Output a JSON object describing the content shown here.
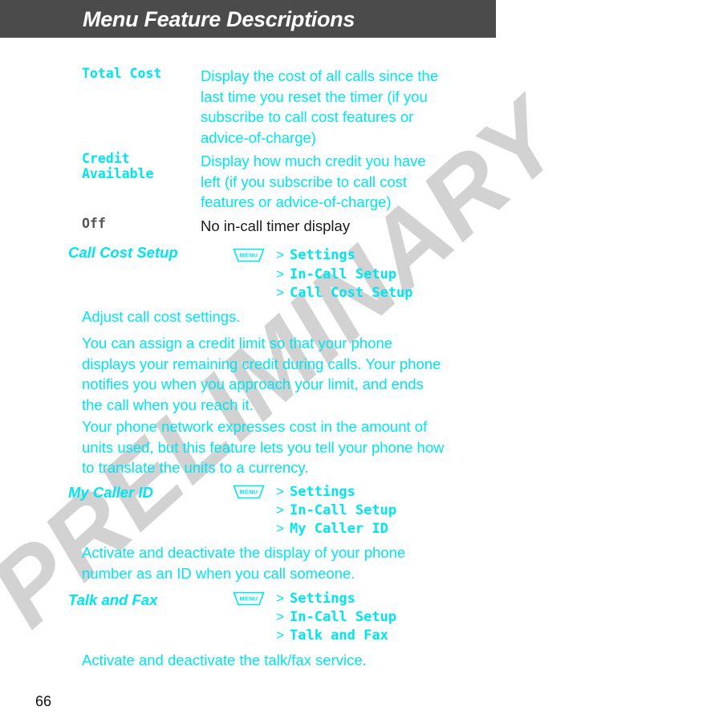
{
  "header": {
    "title": "Menu Feature Descriptions",
    "bar_color": "#4b4b4b",
    "text_color": "#ffffff"
  },
  "watermark": {
    "text": "PRELIMINARY",
    "color": "#d2d2d2"
  },
  "colors": {
    "accent_cyan": "#00e5f2",
    "body_dark": "#1a1a1a",
    "term_gray": "#555555"
  },
  "definitions": [
    {
      "term": "Total Cost",
      "term_color": "#00e5f2",
      "desc": "Display the cost of all calls since the last time you reset the timer (if you subscribe to call cost features or advice-of-charge)",
      "desc_color": "#00e5f2"
    },
    {
      "term": "Credit Available",
      "term_color": "#00e5f2",
      "desc": "Display how much credit you have left (if you subscribe to call cost features or advice-of-charge)",
      "desc_color": "#00e5f2"
    },
    {
      "term": "Off",
      "term_color": "#555555",
      "desc": "No in-call timer display",
      "desc_color": "#1a1a1a"
    }
  ],
  "features": [
    {
      "name": "Call Cost Setup",
      "menu_icon": "menu-key-icon",
      "menu_icon_label": "MENU",
      "path": [
        "Settings",
        "In-Call Setup",
        "Call Cost Setup"
      ],
      "paragraphs": [
        "Adjust call cost settings.",
        "You can assign a credit limit so that your phone displays your remaining credit during calls. Your phone notifies you when you approach your limit, and ends the call when you reach it.",
        "Your phone network expresses cost in the amount of units used, but this feature lets you tell your phone how to translate the units to a currency."
      ]
    },
    {
      "name": "My Caller ID",
      "menu_icon": "menu-key-icon",
      "menu_icon_label": "MENU",
      "path": [
        "Settings",
        "In-Call Setup",
        "My Caller ID"
      ],
      "paragraphs": [
        "Activate and deactivate the display of your phone number as an ID when you call someone."
      ]
    },
    {
      "name": "Talk and Fax",
      "menu_icon": "menu-key-icon",
      "menu_icon_label": "MENU",
      "path": [
        "Settings",
        "In-Call Setup",
        "Talk and Fax"
      ],
      "paragraphs": [
        "Activate and deactivate the talk/fax service."
      ]
    }
  ],
  "footer": {
    "page_number": "66"
  }
}
